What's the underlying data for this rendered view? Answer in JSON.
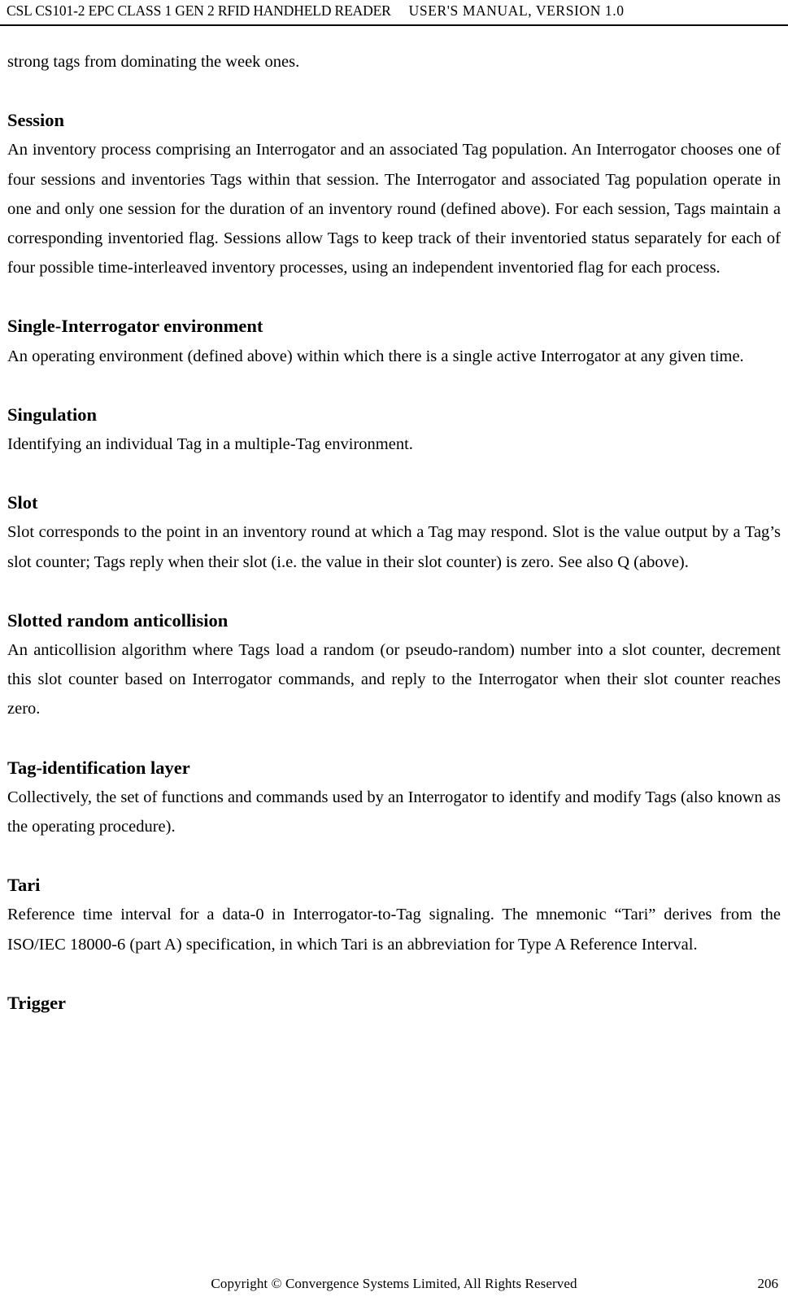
{
  "header": {
    "left": "CSL CS101-2 EPC CLASS 1 GEN 2 RFID HANDHELD READER",
    "right": "USER'S  MANUAL,  VERSION  1.0"
  },
  "body": {
    "continued_paragraph": "strong tags from dominating the week ones.",
    "sections": [
      {
        "heading": "Session",
        "paragraph": "An inventory process comprising an Interrogator and an associated Tag population. An Interrogator chooses one of four sessions and inventories Tags within that session. The Interrogator and associated Tag population operate in one and only one session for the duration of an inventory round (defined above). For each session, Tags maintain a corresponding inventoried flag. Sessions allow Tags to keep track of their inventoried status separately for each of four possible time-interleaved inventory processes, using an independent inventoried flag for each process."
      },
      {
        "heading": "Single-Interrogator environment",
        "paragraph": "An operating environment (defined above) within which there is a single active Interrogator at any given time."
      },
      {
        "heading": "Singulation",
        "paragraph": "Identifying an individual Tag in a multiple-Tag environment."
      },
      {
        "heading": "Slot",
        "paragraph": "Slot corresponds to the point in an inventory round at which a Tag may respond. Slot is the value output by a Tag’s slot counter; Tags reply when their slot (i.e. the value in their slot counter) is zero. See also Q (above)."
      },
      {
        "heading": "Slotted random anticollision",
        "paragraph": "An anticollision algorithm where Tags load a random (or pseudo-random) number into a slot counter, decrement this slot counter based on Interrogator commands, and reply to the Interrogator when their slot counter reaches zero."
      },
      {
        "heading": "Tag-identification layer",
        "paragraph": "Collectively, the set of functions and commands used by an Interrogator to identify and modify Tags (also known as the operating procedure)."
      },
      {
        "heading": "Tari",
        "paragraph": "Reference time interval for a data-0 in Interrogator-to-Tag signaling. The mnemonic “Tari” derives from the ISO/IEC 18000-6 (part A) specification, in which Tari is an abbreviation for Type A Reference Interval."
      },
      {
        "heading": "Trigger",
        "paragraph": ""
      }
    ]
  },
  "footer": {
    "copyright": "Copyright © Convergence Systems Limited, All Rights Reserved",
    "page_number": "206"
  }
}
